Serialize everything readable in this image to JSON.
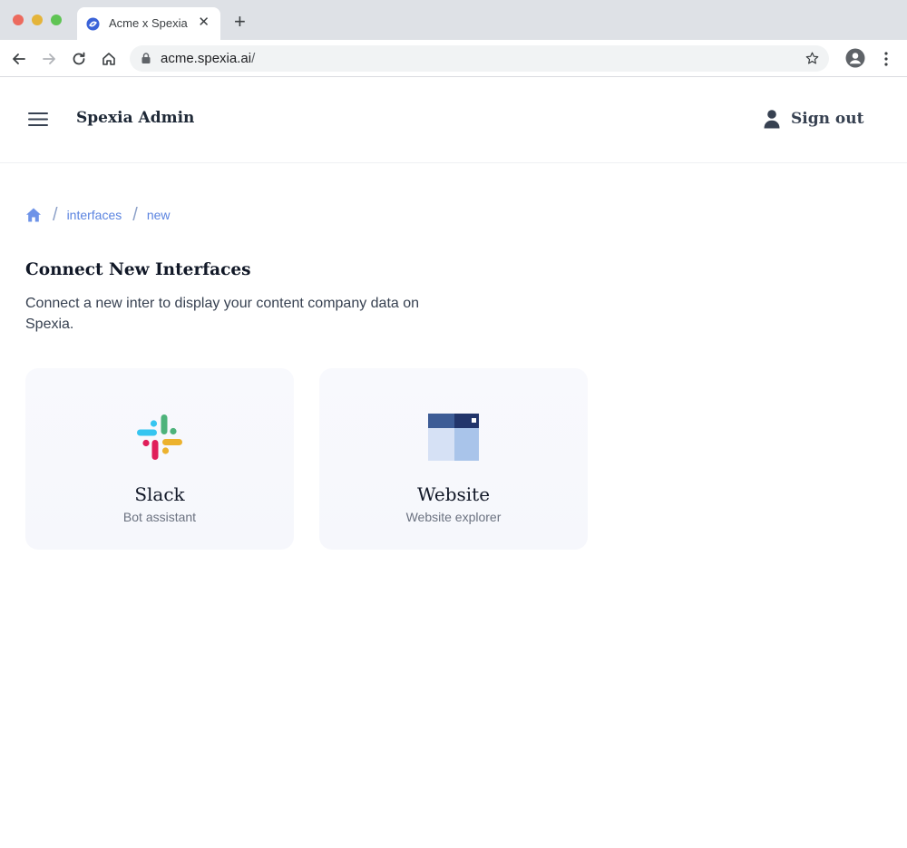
{
  "browser": {
    "tab_title": "Acme x Spexia",
    "tab_close": "✕",
    "new_tab": "+",
    "url_host": "acme.spexia.ai",
    "url_path": "/"
  },
  "header": {
    "title": "Spexia Admin",
    "signout_label": "Sign out"
  },
  "breadcrumb": {
    "separator": "/",
    "items": [
      "interfaces",
      "new"
    ]
  },
  "page": {
    "title": "Connect New Interfaces",
    "description": "Connect a new inter to display your content company data on Spexia."
  },
  "cards": [
    {
      "title": "Slack",
      "subtitle": "Bot assistant",
      "icon": "slack-logo-icon"
    },
    {
      "title": "Website",
      "subtitle": "Website explorer",
      "icon": "website-icon"
    }
  ],
  "colors": {
    "accent": "#5b84e0",
    "text": "#111827",
    "card_bg": "#f7f8fc"
  }
}
